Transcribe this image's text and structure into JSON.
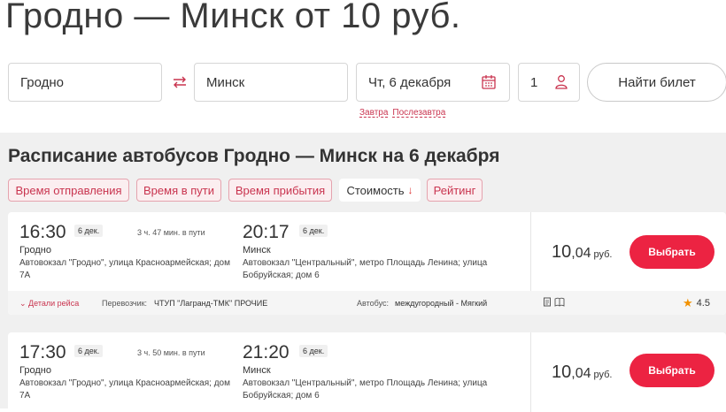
{
  "hero": {
    "title": "Гродно — Минск от 10 руб."
  },
  "search": {
    "from": "Гродно",
    "to": "Минск",
    "date": "Чт, 6 декабря",
    "passengers": "1",
    "find_label": "Найти билет",
    "quick_dates": [
      "Завтра",
      "Послезавтра"
    ],
    "icons": {
      "swap": "swap-icon",
      "calendar": "calendar-icon",
      "passenger": "person-icon"
    }
  },
  "schedule": {
    "title": "Расписание автобусов Гродно — Минск на 6 декабря",
    "sort_options": [
      {
        "label": "Время отправления",
        "active": false
      },
      {
        "label": "Время в пути",
        "active": false
      },
      {
        "label": "Время прибытия",
        "active": false
      },
      {
        "label": "Стоимость",
        "active": true,
        "arrow": "↓"
      },
      {
        "label": "Рейтинг",
        "active": false
      }
    ]
  },
  "trips": [
    {
      "dep_time": "16:30",
      "dep_date": "6 дек.",
      "duration": "3 ч. 47 мин. в пути",
      "arr_time": "20:17",
      "arr_date": "6 дек.",
      "dep_city": "Гродно",
      "dep_addr": "Автовокзал \"Гродно\", улица Красноармейская; дом 7А",
      "arr_city": "Минск",
      "arr_addr": "Автовокзал \"Центральный\", метро Площадь Ленина; улица Бобруйская; дом 6",
      "price_whole": "10",
      "price_cents": ",04",
      "currency": "руб.",
      "select_label": "Выбрать",
      "details_label": "Детали рейса",
      "carrier_label": "Перевозчик:",
      "carrier": "ЧТУП \"Лагранд-ТМК\" ПРОЧИЕ",
      "bus_label": "Автобус:",
      "bus": "междугородный - Мягкий",
      "rating": "4.5"
    },
    {
      "dep_time": "17:30",
      "dep_date": "6 дек.",
      "duration": "3 ч. 50 мин. в пути",
      "arr_time": "21:20",
      "arr_date": "6 дек.",
      "dep_city": "Гродно",
      "dep_addr": "Автовокзал \"Гродно\", улица Красноармейская; дом 7А",
      "arr_city": "Минск",
      "arr_addr": "Автовокзал \"Центральный\", метро Площадь Ленина; улица Бобруйская; дом 6",
      "price_whole": "10",
      "price_cents": ",04",
      "currency": "руб.",
      "select_label": "Выбрать"
    }
  ],
  "colors": {
    "accent": "#ec2342",
    "link": "#c9344f",
    "background": "#f0f0f0",
    "rating_star": "#f29100"
  }
}
